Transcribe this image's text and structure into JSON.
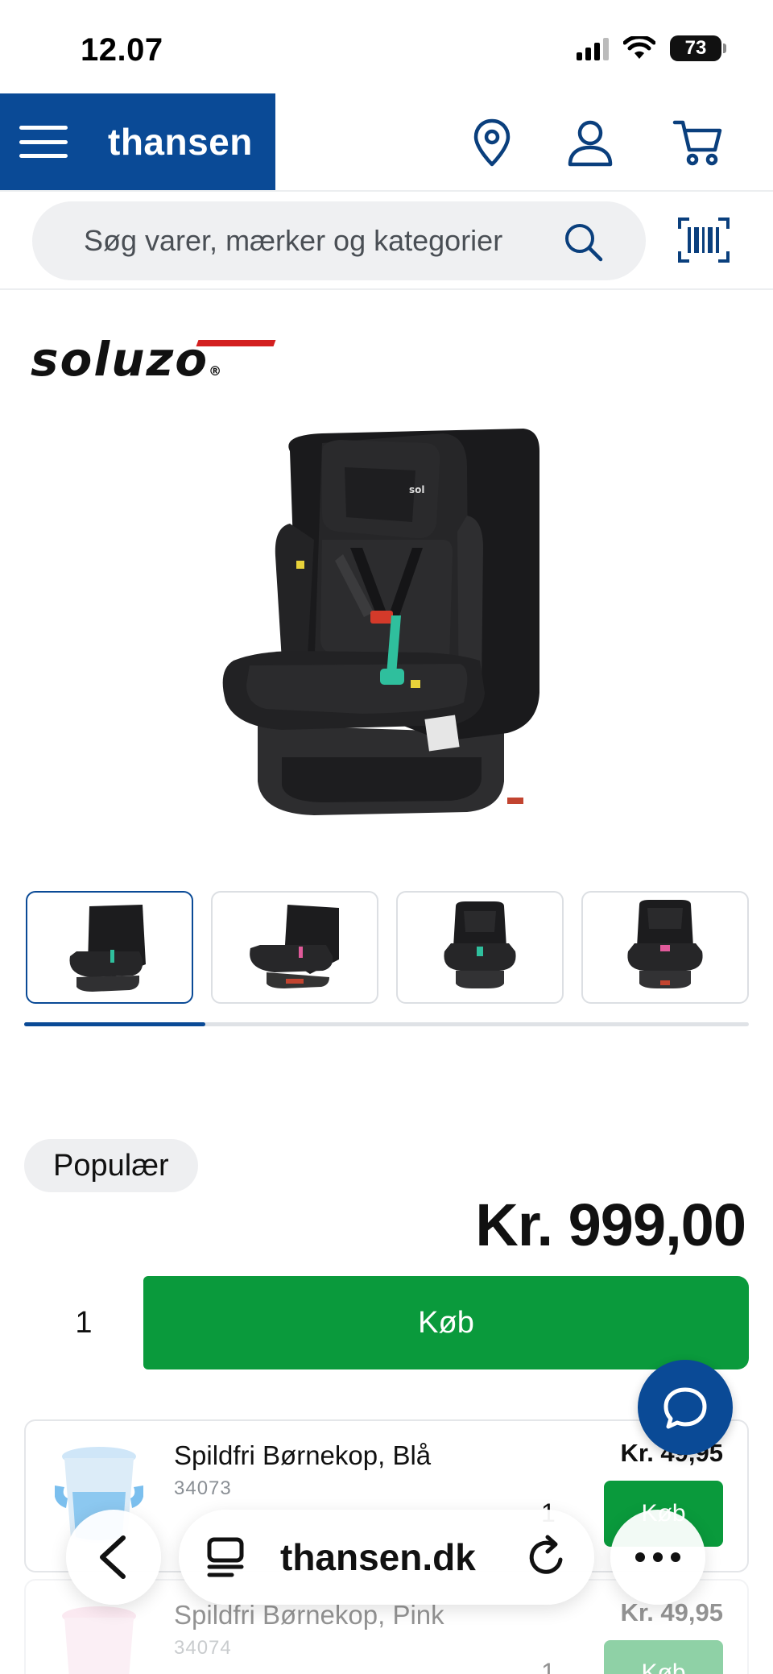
{
  "status_bar": {
    "time": "12.07",
    "battery": "73"
  },
  "header": {
    "brand": "thansen",
    "icons": [
      "menu-icon",
      "location-pin-icon",
      "user-icon",
      "cart-icon"
    ],
    "brand_color": "#0a4a96"
  },
  "search": {
    "placeholder": "Søg varer, mærker og kategorier",
    "icons": [
      "search-icon",
      "barcode-scanner-icon"
    ]
  },
  "product": {
    "brand_logo": "soluzo",
    "badge": "Populær",
    "price": "Kr. 999,00",
    "quantity": "1",
    "buy_label": "Køb",
    "thumbnail_count": 4,
    "gallery_progress": 0.25
  },
  "related": [
    {
      "name": "Spildfri Børnekop, Blå",
      "sku": "34073",
      "price": "Kr. 49,95",
      "quantity": "1",
      "buy_label": "Køb"
    },
    {
      "name": "Spildfri Børnekop, Pink",
      "sku": "34074",
      "price": "Kr. 49,95",
      "quantity": "1",
      "buy_label": "Køb"
    }
  ],
  "browser": {
    "url": "thansen.dk",
    "icons": [
      "back-icon",
      "reader-icon",
      "reload-icon",
      "more-icon"
    ]
  },
  "colors": {
    "buy_green": "#0a9a3c",
    "brand_blue": "#0a4a96"
  }
}
